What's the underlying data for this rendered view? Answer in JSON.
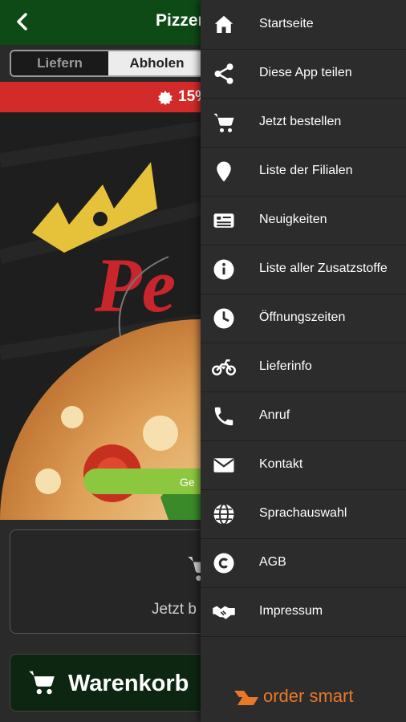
{
  "app": {
    "title": "Pizzer",
    "delivery_tabs": [
      "Liefern",
      "Abholen"
    ],
    "promo_text": "15%",
    "hero_button": "Ge",
    "order_text": "Jetzt b",
    "cart_label": "Warenkorb"
  },
  "drawer": {
    "items": [
      {
        "label": "Startseite",
        "icon": "home-icon"
      },
      {
        "label": "Diese App teilen",
        "icon": "share-icon"
      },
      {
        "label": "Jetzt bestellen",
        "icon": "cart-icon"
      },
      {
        "label": "Liste der Filialen",
        "icon": "location-pin-icon"
      },
      {
        "label": "Neuigkeiten",
        "icon": "news-icon"
      },
      {
        "label": "Liste aller Zusatzstoffe",
        "icon": "info-icon"
      },
      {
        "label": "Öffnungszeiten",
        "icon": "clock-icon"
      },
      {
        "label": "Lieferinfo",
        "icon": "motorbike-icon"
      },
      {
        "label": "Anruf",
        "icon": "phone-icon"
      },
      {
        "label": "Kontakt",
        "icon": "mail-icon"
      },
      {
        "label": "Sprachauswahl",
        "icon": "globe-icon"
      },
      {
        "label": "AGB",
        "icon": "copyright-icon"
      },
      {
        "label": "Impressum",
        "icon": "handshake-icon"
      }
    ],
    "brand": "order smart"
  },
  "colors": {
    "topbar": "#0e4a16",
    "promo": "#d32a2a",
    "drawer": "#2c2c2c",
    "brand_orange": "#e8782a",
    "hero_button": "#8dc63f"
  }
}
